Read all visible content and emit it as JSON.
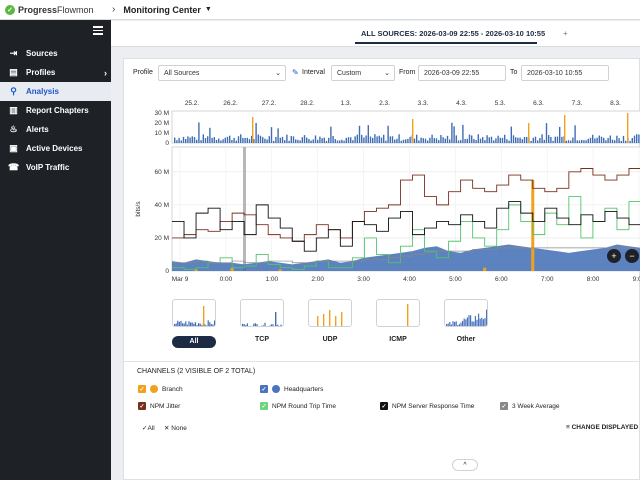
{
  "app": {
    "brand_bold": "Progress",
    "brand_light": "Flowmon",
    "breadcrumb": "Monitoring Center"
  },
  "sidebar": {
    "items": [
      {
        "label": "Sources",
        "icon": "sources-icon"
      },
      {
        "label": "Profiles",
        "icon": "profiles-icon"
      },
      {
        "label": "Analysis",
        "icon": "search-icon"
      },
      {
        "label": "Report Chapters",
        "icon": "report-icon"
      },
      {
        "label": "Alerts",
        "icon": "flame-icon"
      },
      {
        "label": "Active Devices",
        "icon": "devices-icon"
      },
      {
        "label": "VoIP Traffic",
        "icon": "voip-icon"
      }
    ],
    "active_index": 2
  },
  "source_tab": {
    "label": "ALL SOURCES: 2026-03-09 22:55 - 2026-03-10 10:55",
    "add": "+"
  },
  "filters": {
    "profile_label": "Profile",
    "profile_value": "All Sources",
    "interval_label": "Interval",
    "interval_value": "Custom",
    "from_label": "From",
    "from_value": "2026-03-09 22:55",
    "to_label": "To",
    "to_value": "2026-03-10 10:55"
  },
  "chart_data": [
    {
      "type": "bar",
      "name": "overview",
      "ylabel": "",
      "yticks": [
        "30 M",
        "20 M",
        "10 M",
        "0"
      ],
      "ylim": [
        0,
        30
      ],
      "x_tick_labels": [
        "25.2.",
        "26.2.",
        "27.2.",
        "28.2.",
        "1.3.",
        "2.3.",
        "3.3.",
        "4.3.",
        "5.3.",
        "6.3.",
        "7.3.",
        "8.3."
      ]
    },
    {
      "type": "line",
      "name": "detail",
      "ylabel": "bits/s",
      "yticks": [
        "60 M",
        "40 M",
        "20 M",
        "0"
      ],
      "ylim": [
        0,
        75
      ],
      "x_tick_labels": [
        "Mar 9",
        "0:00",
        "1:00",
        "2:00",
        "3:00",
        "4:00",
        "5:00",
        "6:00",
        "7:00",
        "8:00",
        "9:00"
      ],
      "grid": true,
      "series": [
        {
          "name": "Headquarters",
          "color": "#3f6db5",
          "values": [
            6,
            5,
            7,
            6,
            5,
            5,
            4,
            5,
            6,
            5,
            4,
            5,
            6,
            7,
            5,
            6,
            8,
            9,
            10,
            11,
            12,
            14,
            15,
            12,
            11,
            13,
            14,
            15,
            16,
            15,
            14,
            13,
            12,
            11,
            12,
            13,
            14,
            16,
            15,
            14
          ]
        },
        {
          "name": "Branch",
          "color": "#f0a21f",
          "values": [
            0,
            0,
            1,
            0,
            0,
            2,
            0,
            0,
            0,
            1,
            0,
            0,
            0,
            0,
            0,
            0,
            0,
            0,
            0,
            0,
            0,
            0,
            0,
            0,
            0,
            0,
            2,
            0,
            0,
            0,
            55,
            0,
            0,
            0,
            0,
            0,
            0,
            0,
            0,
            0
          ]
        },
        {
          "name": "NPM Jitter",
          "color": "#7a2f1e",
          "values": [
            20,
            22,
            25,
            24,
            30,
            35,
            34,
            28,
            22,
            20,
            18,
            22,
            28,
            25,
            20,
            30,
            36,
            38,
            40,
            55,
            58,
            45,
            40,
            48,
            55,
            50,
            48,
            52,
            58,
            55,
            50,
            48,
            50,
            60,
            62,
            58,
            55,
            58,
            62,
            60
          ]
        },
        {
          "name": "NPM Round Trip Time",
          "color": "#52c46b",
          "values": [
            2,
            1,
            2,
            5,
            8,
            2,
            3,
            10,
            4,
            2,
            1,
            3,
            6,
            2,
            2,
            8,
            20,
            10,
            5,
            15,
            25,
            12,
            8,
            18,
            30,
            20,
            15,
            25,
            40,
            30,
            22,
            35,
            28,
            45,
            20,
            30,
            38,
            25,
            42,
            35
          ]
        },
        {
          "name": "NPM Server Response Time",
          "color": "#111111",
          "values": [
            30,
            20,
            35,
            38,
            25,
            30,
            22,
            40,
            32,
            26,
            18,
            12,
            20,
            25,
            15,
            30,
            28,
            24,
            32,
            36,
            22,
            26,
            30,
            28,
            34,
            30,
            26,
            38,
            42,
            35,
            30,
            38,
            32,
            28,
            34,
            30,
            36,
            32,
            28,
            30
          ]
        },
        {
          "name": "3 Week Average",
          "color": "#888888",
          "values": [
            5,
            5,
            6,
            5,
            5,
            6,
            5,
            5,
            6,
            6,
            5,
            5,
            6,
            6,
            6,
            6,
            7,
            7,
            8,
            9,
            10,
            11,
            12,
            12,
            12,
            13,
            13,
            14,
            14,
            14,
            14,
            14,
            14,
            14,
            14,
            14,
            14,
            14,
            14,
            14
          ]
        }
      ]
    }
  ],
  "thumbnails": [
    {
      "label": "All",
      "active": true
    },
    {
      "label": "TCP",
      "active": false
    },
    {
      "label": "UDP",
      "active": false
    },
    {
      "label": "ICMP",
      "active": false
    },
    {
      "label": "Other",
      "active": false
    }
  ],
  "channels": {
    "header": "CHANNELS (2 VISIBLE OF 2 TOTAL)",
    "items": [
      {
        "label": "Branch",
        "color": "#f0a21f",
        "dot": true
      },
      {
        "label": "Headquarters",
        "color": "#4a74c0",
        "dot": true
      },
      {
        "label": "NPM Jitter",
        "color": "#7a2f1e",
        "dot": false
      },
      {
        "label": "NPM Round Trip Time",
        "color": "#6fd47e",
        "dot": false
      },
      {
        "label": "NPM Server Response Time",
        "color": "#111111",
        "dot": false
      },
      {
        "label": "3 Week Average",
        "color": "#888888",
        "dot": false
      }
    ]
  },
  "actions": {
    "all": "All",
    "none": "None",
    "change_displayed": "CHANGE DISPLAYED",
    "collapse": "^"
  }
}
